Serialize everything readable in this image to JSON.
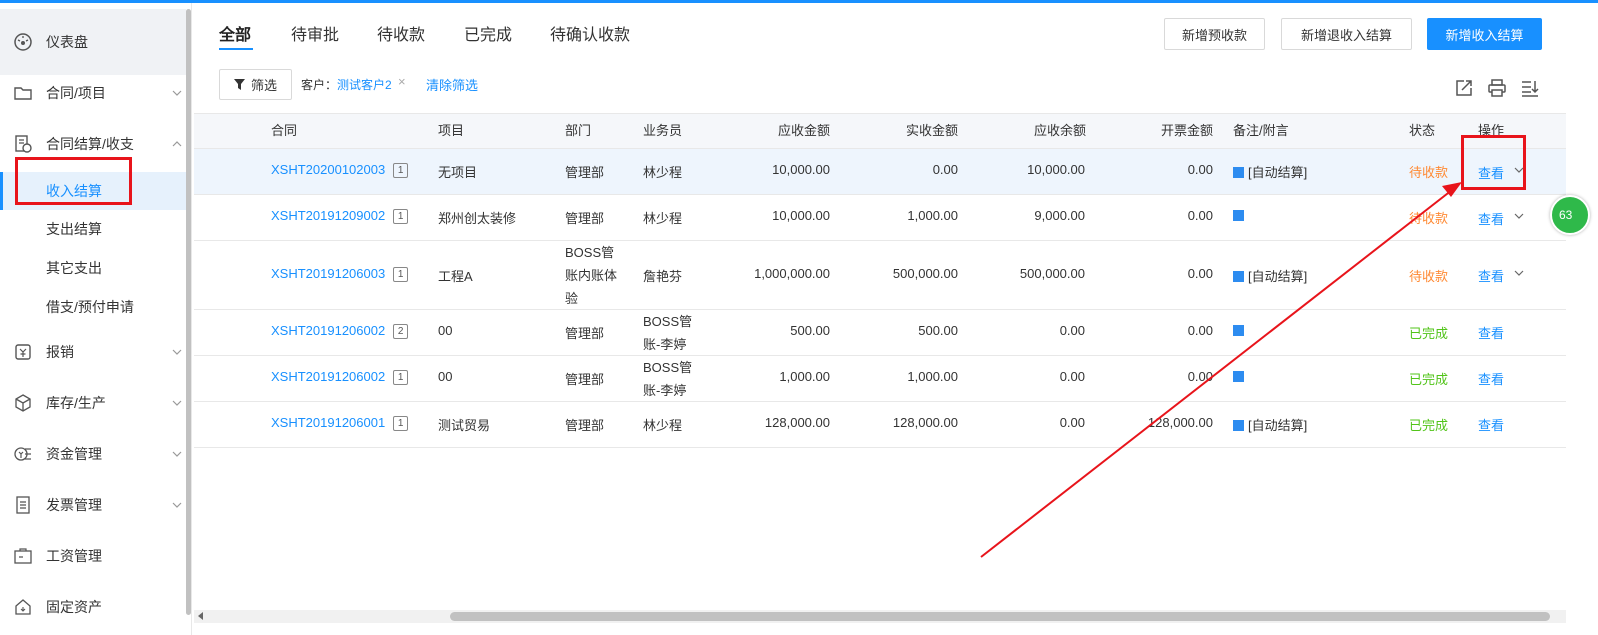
{
  "sidebar": {
    "items": [
      {
        "label": "仪表盘",
        "icon": "dashboard-icon"
      },
      {
        "label": "合同/项目",
        "icon": "folder-icon"
      },
      {
        "label": "合同结算/收支",
        "icon": "settlement-icon"
      },
      {
        "label": "报销",
        "icon": "reimburse-icon"
      },
      {
        "label": "库存/生产",
        "icon": "box-icon"
      },
      {
        "label": "资金管理",
        "icon": "fund-icon"
      },
      {
        "label": "发票管理",
        "icon": "invoice-icon"
      },
      {
        "label": "工资管理",
        "icon": "salary-icon"
      },
      {
        "label": "固定资产",
        "icon": "asset-icon"
      }
    ],
    "sub_items": [
      "收入结算",
      "支出结算",
      "其它支出",
      "借支/预付申请"
    ],
    "active_sub": "收入结算"
  },
  "tabs": [
    "全部",
    "待审批",
    "待收款",
    "已完成",
    "待确认收款"
  ],
  "active_tab": "全部",
  "buttons": {
    "new_prepay": "新增预收款",
    "new_refund": "新增退收入结算",
    "new_income": "新增收入结算"
  },
  "filter": {
    "button": "筛选",
    "chip_key": "客户：",
    "chip_value": "测试客户2",
    "chip_close": "×",
    "clear": "清除筛选"
  },
  "table": {
    "headers": [
      "合同",
      "项目",
      "部门",
      "业务员",
      "应收金额",
      "实收金额",
      "应收余额",
      "开票金额",
      "备注/附言",
      "状态",
      "操作"
    ],
    "rows": [
      {
        "contract": "XSHT20200102003",
        "badge": "1",
        "project": "无项目",
        "dept": "管理部",
        "staff": "林少程",
        "receivable": "10,000.00",
        "received": "0.00",
        "balance": "10,000.00",
        "invoiced": "0.00",
        "note": "[自动结算]",
        "status": "待收款",
        "action": "查看"
      },
      {
        "contract": "XSHT20191209002",
        "badge": "1",
        "project": "郑州创太装修",
        "dept": "管理部",
        "staff": "林少程",
        "receivable": "10,000.00",
        "received": "1,000.00",
        "balance": "9,000.00",
        "invoiced": "0.00",
        "note": "",
        "status": "待收款",
        "action": "查看"
      },
      {
        "contract": "XSHT20191206003",
        "badge": "1",
        "project": "工程A",
        "dept": "BOSS管账内账体验",
        "staff": "詹艳芬",
        "receivable": "1,000,000.00",
        "received": "500,000.00",
        "balance": "500,000.00",
        "invoiced": "0.00",
        "note": "[自动结算]",
        "status": "待收款",
        "action": "查看"
      },
      {
        "contract": "XSHT20191206002",
        "badge": "2",
        "project": "00",
        "dept": "管理部",
        "staff": "BOSS管账-李婷",
        "receivable": "500.00",
        "received": "500.00",
        "balance": "0.00",
        "invoiced": "0.00",
        "note": "",
        "status": "已完成",
        "action": "查看"
      },
      {
        "contract": "XSHT20191206002",
        "badge": "1",
        "project": "00",
        "dept": "管理部",
        "staff": "BOSS管账-李婷",
        "receivable": "1,000.00",
        "received": "1,000.00",
        "balance": "0.00",
        "invoiced": "0.00",
        "note": "",
        "status": "已完成",
        "action": "查看"
      },
      {
        "contract": "XSHT20191206001",
        "badge": "1",
        "project": "测试贸易",
        "dept": "管理部",
        "staff": "林少程",
        "receivable": "128,000.00",
        "received": "128,000.00",
        "balance": "0.00",
        "invoiced": "128,000.00",
        "note": "[自动结算]",
        "status": "已完成",
        "action": "查看"
      }
    ]
  },
  "floating_badge": "63",
  "colors": {
    "accent": "#1890ff",
    "pending": "#ff8a34",
    "done": "#52c41a",
    "annotation": "#e8141b"
  }
}
